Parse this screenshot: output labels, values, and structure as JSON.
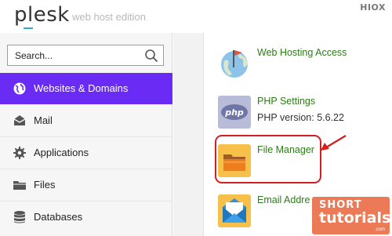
{
  "header": {
    "brand": "plesk",
    "edition": "web host edition",
    "watermark_top": "HIOX"
  },
  "search": {
    "placeholder": "Search..."
  },
  "sidebar": {
    "items": [
      {
        "label": "Websites & Domains",
        "icon": "globe-icon",
        "active": true
      },
      {
        "label": "Mail",
        "icon": "mail-icon",
        "active": false
      },
      {
        "label": "Applications",
        "icon": "gear-icon",
        "active": false
      },
      {
        "label": "Files",
        "icon": "folder-icon",
        "active": false
      },
      {
        "label": "Databases",
        "icon": "database-icon",
        "active": false
      }
    ]
  },
  "tools": [
    {
      "title": "Web Hosting Access",
      "subtitle": "",
      "icon": "web-hosting-icon"
    },
    {
      "title": "PHP Settings",
      "subtitle": "PHP version: 5.6.22",
      "icon": "php-icon"
    },
    {
      "title": "File Manager",
      "subtitle": "",
      "icon": "file-manager-icon"
    },
    {
      "title": "Email Addre",
      "subtitle": "",
      "icon": "email-icon"
    }
  ],
  "php_icon_text": "php",
  "colors": {
    "accent": "#6a2cf5",
    "link_green": "#2b7d16",
    "highlight_red": "#d22020"
  },
  "watermark": {
    "line1": "SHORT",
    "line2": "tutorials",
    "line3": ".com"
  }
}
